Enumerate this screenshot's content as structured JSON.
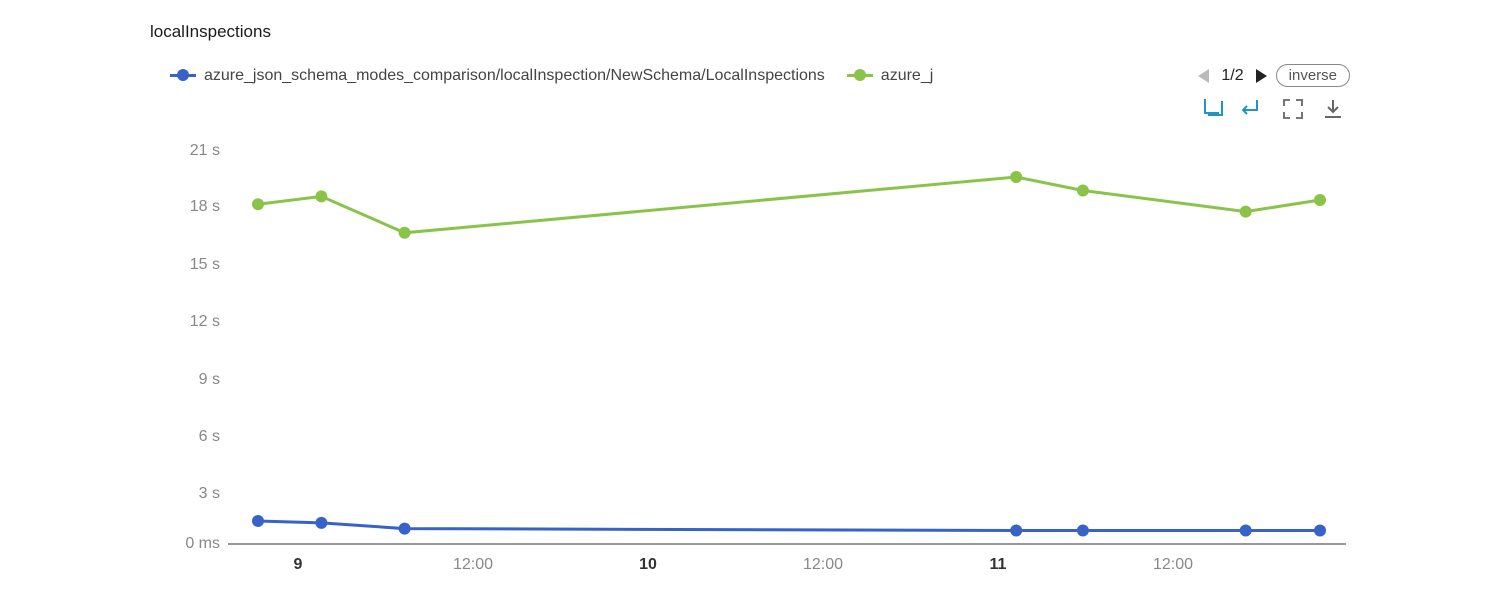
{
  "title": "localInspections",
  "legend": {
    "items": [
      {
        "label": "azure_json_schema_modes_comparison/localInspection/NewSchema/LocalInspections",
        "color": "#3763c8"
      },
      {
        "label": "azure_j",
        "color": "#8bc34a"
      }
    ]
  },
  "pager": {
    "current": "1",
    "total": "2"
  },
  "buttons": {
    "inverse": "inverse"
  },
  "yaxis": {
    "ticks": [
      "21 s",
      "18 s",
      "15 s",
      "12 s",
      "9 s",
      "6 s",
      "3 s",
      "0 ms"
    ]
  },
  "xaxis": {
    "ticks": [
      {
        "label": "9",
        "bold": true
      },
      {
        "label": "12:00",
        "bold": false
      },
      {
        "label": "10",
        "bold": true
      },
      {
        "label": "12:00",
        "bold": false
      },
      {
        "label": "11",
        "bold": true
      },
      {
        "label": "12:00",
        "bold": false
      }
    ]
  },
  "chart_data": {
    "type": "line",
    "title": "localInspections",
    "xlabel": "",
    "ylabel": "",
    "ylim": [
      0,
      21
    ],
    "x_unit": "hours since day-9 00:00",
    "y_unit": "seconds",
    "series": [
      {
        "name": "azure_json_schema_modes_comparison/localInspection/NewSchema/LocalInspections",
        "color": "#3763c8",
        "x": [
          7.9,
          9.5,
          11.6,
          46.6,
          48.3,
          60.1,
          62.0
        ],
        "values": [
          1.2,
          1.1,
          0.8,
          0.7,
          0.7,
          0.7,
          0.7
        ]
      },
      {
        "name": "azure_j",
        "color": "#8bc34a",
        "x": [
          7.9,
          9.5,
          11.6,
          46.6,
          48.3,
          60.1,
          62.0
        ],
        "values": [
          17.7,
          18.1,
          16.2,
          19.1,
          18.4,
          17.3,
          17.9
        ]
      }
    ]
  },
  "colors": {
    "blue": "#3763c8",
    "green": "#8bc34a",
    "axis": "#888",
    "icon": "#2094c4"
  }
}
